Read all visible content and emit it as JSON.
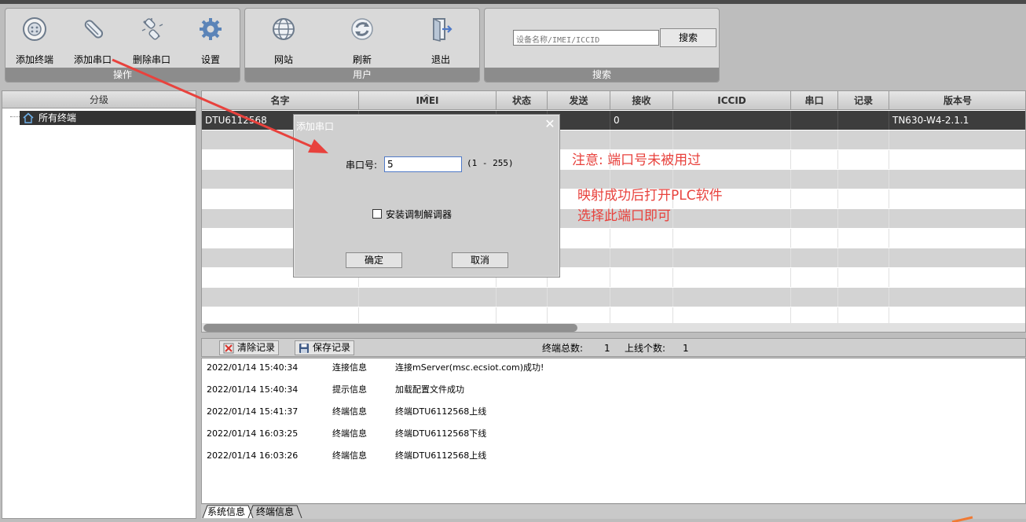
{
  "toolbar": {
    "operate_group": {
      "label": "操作",
      "buttons": [
        {
          "label": "添加终端",
          "icon": "add-terminal-icon"
        },
        {
          "label": "添加串口",
          "icon": "add-serial-icon"
        },
        {
          "label": "删除串口",
          "icon": "delete-serial-icon"
        },
        {
          "label": "设置",
          "icon": "gear-icon"
        }
      ]
    },
    "user_group": {
      "label": "用户",
      "buttons": [
        {
          "label": "网站",
          "icon": "globe-icon"
        },
        {
          "label": "刷新",
          "icon": "refresh-icon"
        },
        {
          "label": "退出",
          "icon": "exit-icon"
        }
      ]
    },
    "search_group": {
      "label": "搜索",
      "placeholder": "设备名称/IMEI/ICCID",
      "button": "搜索"
    }
  },
  "tree": {
    "header": "分级",
    "root": "所有终端"
  },
  "grid": {
    "columns": [
      "名字",
      "IMEI",
      "状态",
      "发送",
      "接收",
      "ICCID",
      "串口",
      "记录",
      "版本号"
    ],
    "rows": [
      [
        "DTU6112568",
        "",
        "",
        "",
        "0",
        "",
        "",
        "",
        "TN630-W4-2.1.1"
      ]
    ]
  },
  "logbar": {
    "clear_label": "清除记录",
    "save_label": "保存记录",
    "total_label": "终端总数:",
    "total_value": "1",
    "online_label": "上线个数:",
    "online_value": "1"
  },
  "log": [
    {
      "time": "2022/01/14 15:40:34",
      "type": "连接信息",
      "msg": "连接mServer(msc.ecsiot.com)成功!"
    },
    {
      "time": "2022/01/14 15:40:34",
      "type": "提示信息",
      "msg": "加载配置文件成功"
    },
    {
      "time": "2022/01/14 15:41:37",
      "type": "终端信息",
      "msg": "终端DTU6112568上线"
    },
    {
      "time": "2022/01/14 16:03:25",
      "type": "终端信息",
      "msg": "终端DTU6112568下线"
    },
    {
      "time": "2022/01/14 16:03:26",
      "type": "终端信息",
      "msg": "终端DTU6112568上线"
    }
  ],
  "tabs": [
    "系统信息",
    "终端信息"
  ],
  "dialog": {
    "title": "添加串口",
    "close": "✕",
    "port_label": "串口号:",
    "port_value": "5",
    "range": "(1 - 255)",
    "modem_label": "安装调制解调器",
    "ok": "确定",
    "cancel": "取消"
  },
  "annotations": {
    "note1": "注意:  端口号未被用过",
    "note2": "映射成功后打开PLC软件",
    "note3": "选择此端口即可",
    "color": "#e8423d"
  }
}
